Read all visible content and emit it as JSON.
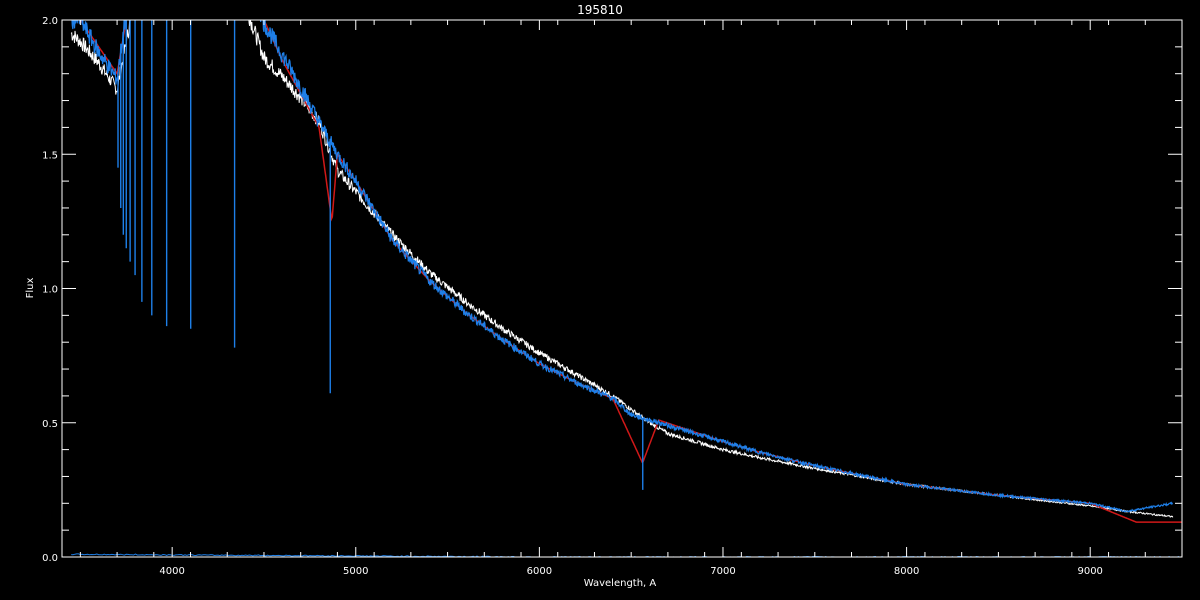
{
  "chart_data": {
    "type": "line",
    "title": "195810",
    "xlabel": "Wavelength, A",
    "ylabel": "Flux",
    "xlim": [
      3400,
      9500
    ],
    "ylim": [
      0.0,
      2.0
    ],
    "x_ticks": [
      {
        "value": 4000,
        "label": "4000"
      },
      {
        "value": 5000,
        "label": "5000"
      },
      {
        "value": 6000,
        "label": "6000"
      },
      {
        "value": 7000,
        "label": "7000"
      },
      {
        "value": 8000,
        "label": "8000"
      },
      {
        "value": 9000,
        "label": "9000"
      }
    ],
    "y_ticks": [
      {
        "value": 0.0,
        "label": "0.0"
      },
      {
        "value": 0.5,
        "label": "0.5"
      },
      {
        "value": 1.0,
        "label": "1.0"
      },
      {
        "value": 1.5,
        "label": "1.5"
      },
      {
        "value": 2.0,
        "label": "2.0"
      }
    ],
    "grid": false,
    "colors": {
      "background": "#000000",
      "axes": "#ffffff",
      "observed": "#ffffff",
      "corrected": "#1e7fe8",
      "model": "#d01818"
    },
    "series": [
      {
        "key": "observed",
        "x": [
          3450,
          3500,
          3600,
          3700,
          3800,
          3900,
          4000,
          4200,
          4400,
          4500,
          4600,
          4700,
          4800,
          4900,
          5000,
          5200,
          5400,
          5600,
          5800,
          6000,
          6200,
          6400,
          6500,
          6600,
          6700,
          7000,
          7200,
          7500,
          8000,
          8500,
          9000,
          9200,
          9450
        ],
        "y": [
          1.95,
          1.92,
          1.84,
          1.74,
          2.1,
          2.1,
          2.2,
          2.15,
          2.05,
          1.86,
          1.79,
          1.71,
          1.62,
          1.44,
          1.36,
          1.2,
          1.06,
          0.95,
          0.85,
          0.76,
          0.68,
          0.6,
          0.55,
          0.5,
          0.46,
          0.4,
          0.37,
          0.33,
          0.27,
          0.23,
          0.19,
          0.17,
          0.15
        ]
      },
      {
        "key": "corrected",
        "x": [
          3450,
          3500,
          3600,
          3700,
          3800,
          4000,
          4200,
          4400,
          4500,
          4600,
          4700,
          4800,
          4900,
          5000,
          5200,
          5400,
          5600,
          5800,
          6000,
          6200,
          6400,
          6500,
          6600,
          6700,
          7000,
          7200,
          7500,
          8000,
          8500,
          9000,
          9200,
          9450
        ],
        "y": [
          2.0,
          2.0,
          1.88,
          1.78,
          2.3,
          2.6,
          2.45,
          2.2,
          1.99,
          1.87,
          1.75,
          1.62,
          1.5,
          1.4,
          1.18,
          1.03,
          0.91,
          0.81,
          0.72,
          0.65,
          0.59,
          0.53,
          0.51,
          0.49,
          0.43,
          0.39,
          0.34,
          0.27,
          0.23,
          0.2,
          0.17,
          0.2
        ]
      },
      {
        "key": "model",
        "x": [
          3500,
          3700,
          3800,
          4000,
          4200,
          4400,
          4600,
          4800,
          4870,
          4900,
          5000,
          5200,
          5400,
          5600,
          5800,
          6000,
          6200,
          6400,
          6562,
          6650,
          7000,
          7200,
          7500,
          8000,
          8500,
          9000,
          9250,
          9500
        ],
        "y": [
          2.0,
          1.8,
          2.2,
          2.5,
          2.4,
          2.15,
          1.85,
          1.6,
          1.25,
          1.5,
          1.4,
          1.18,
          1.03,
          0.91,
          0.81,
          0.72,
          0.65,
          0.59,
          0.35,
          0.51,
          0.43,
          0.39,
          0.34,
          0.27,
          0.23,
          0.2,
          0.13,
          0.13
        ]
      },
      {
        "key": "baseline",
        "x": [
          3450,
          6000,
          9500
        ],
        "y": [
          0.01,
          0.0,
          0.0
        ]
      }
    ],
    "absorption_lines": [
      {
        "x": 3705,
        "depth_to": 1.45
      },
      {
        "x": 3720,
        "depth_to": 1.3
      },
      {
        "x": 3734,
        "depth_to": 1.2
      },
      {
        "x": 3750,
        "depth_to": 1.15
      },
      {
        "x": 3771,
        "depth_to": 1.1
      },
      {
        "x": 3798,
        "depth_to": 1.05
      },
      {
        "x": 3835,
        "depth_to": 0.95
      },
      {
        "x": 3889,
        "depth_to": 0.9
      },
      {
        "x": 3970,
        "depth_to": 0.86
      },
      {
        "x": 4101,
        "depth_to": 0.85
      },
      {
        "x": 4340,
        "depth_to": 0.78
      },
      {
        "x": 4861,
        "depth_to": 0.61
      },
      {
        "x": 6563,
        "depth_to": 0.25
      }
    ]
  }
}
